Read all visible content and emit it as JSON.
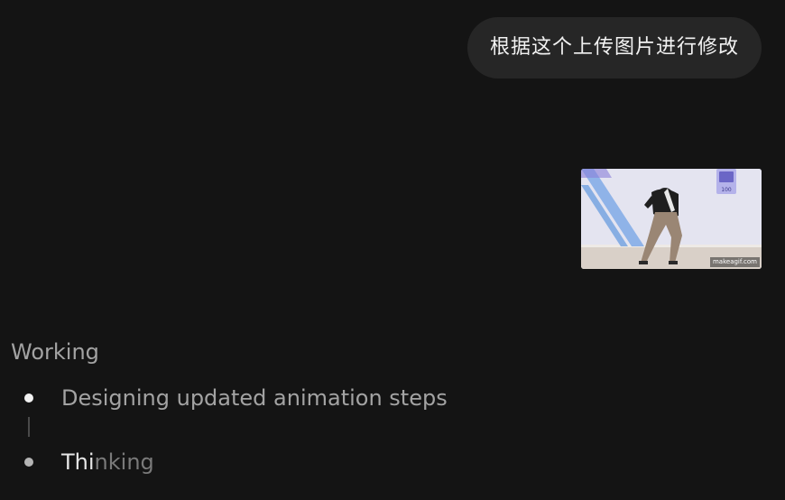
{
  "conversation": {
    "user_message": "根据这个上传图片进行修改",
    "attachment": {
      "icon": "gif-thumbnail-dancer",
      "watermark": "makeagif.com",
      "sign_text": "100"
    }
  },
  "status": {
    "title": "Working",
    "steps": [
      {
        "label": "Designing updated animation steps",
        "state": "done"
      },
      {
        "label_highlight": "Thi",
        "label_rest": "nking",
        "state": "active"
      }
    ]
  },
  "colors": {
    "background": "#141414",
    "bubble": "#262626",
    "text_primary": "#f2f2f2",
    "text_secondary": "#a3a3a3"
  }
}
